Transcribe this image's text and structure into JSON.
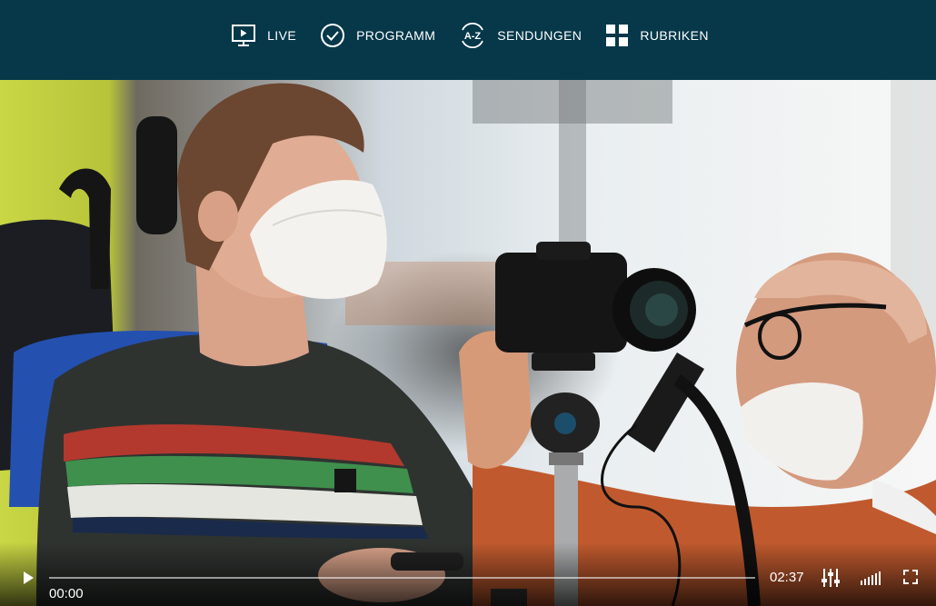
{
  "nav": {
    "items": [
      {
        "label": "LIVE",
        "icon": "monitor-play-icon"
      },
      {
        "label": "PROGRAMM",
        "icon": "clock-icon"
      },
      {
        "label": "SENDUNGEN",
        "icon": "a-z-icon"
      },
      {
        "label": "RUBRIKEN",
        "icon": "grid-icon"
      }
    ],
    "az_glyph": "A-Z"
  },
  "player": {
    "current_time": "00:00",
    "total_time": "02:37",
    "progress": 0.0,
    "controls": {
      "play": "play-icon",
      "settings": "equalizer-icon",
      "volume": "volume-bars-icon",
      "fullscreen": "fullscreen-icon"
    }
  },
  "colors": {
    "nav_background": "#06384a",
    "nav_text": "#ffffff",
    "controls_text": "#ffffff"
  }
}
